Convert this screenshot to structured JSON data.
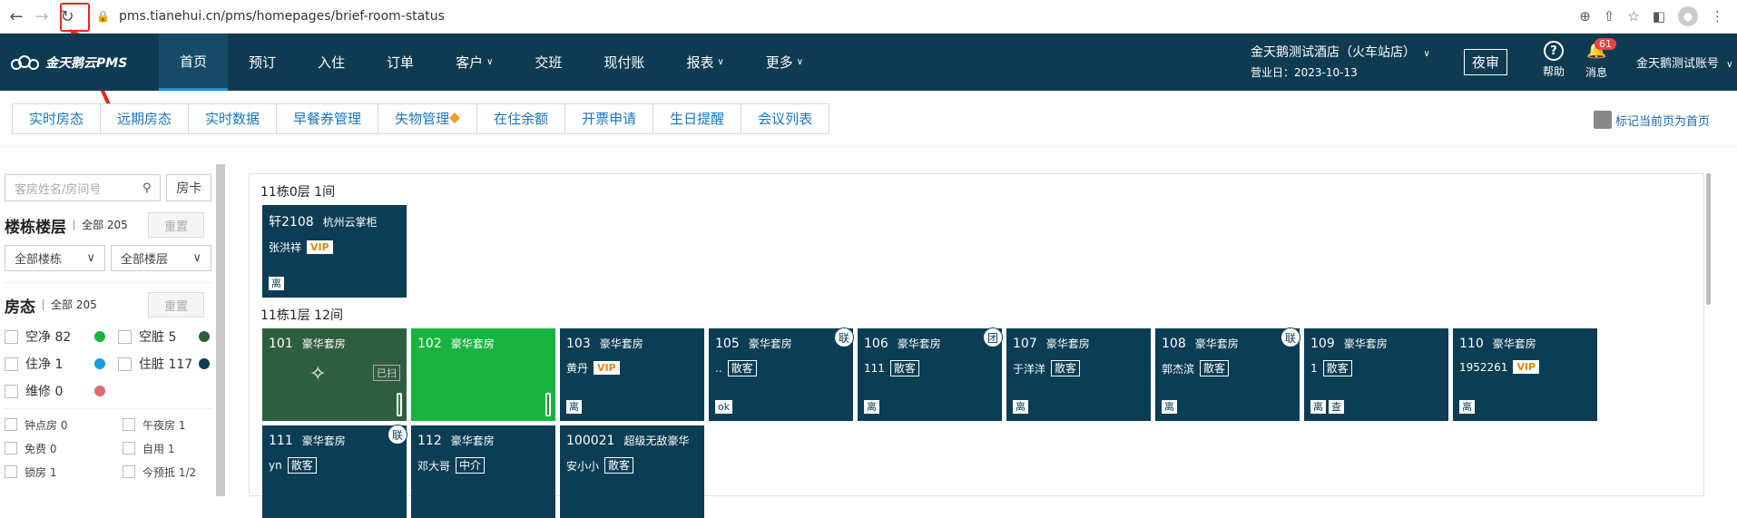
{
  "browser": {
    "url": "pms.tianehui.cn/pms/homepages/brief-room-status"
  },
  "nav": {
    "logo": "金天鹅云PMS",
    "items": [
      {
        "label": "首页",
        "active": true
      },
      {
        "label": "预订"
      },
      {
        "label": "入住"
      },
      {
        "label": "订单"
      },
      {
        "label": "客户",
        "dropdown": true
      },
      {
        "label": "交班"
      },
      {
        "label": "现付账"
      },
      {
        "label": "报表",
        "dropdown": true
      },
      {
        "label": "更多",
        "dropdown": true
      }
    ],
    "hotel_name": "金天鹅测试酒店（火车站店）",
    "business_day": "营业日：2023-10-13",
    "night_audit": "夜审",
    "help": "帮助",
    "messages": "消息",
    "message_count": "61",
    "account": "金天鹅测试账号"
  },
  "tabs": [
    "实时房态",
    "远期房态",
    "实时数据",
    "早餐券管理",
    "失物管理",
    "在住余额",
    "开票申请",
    "生日提醒",
    "会议列表"
  ],
  "mark_home": "标记当前页为首页",
  "sidebar": {
    "search_placeholder": "客房姓名/房间号",
    "card_button": "房卡",
    "building_title": "楼栋楼层",
    "building_all": "全部 205",
    "reset": "重置",
    "building_select": "全部楼栋",
    "floor_select": "全部楼层",
    "status_title": "房态",
    "status_all": "全部 205",
    "statuses": [
      {
        "label": "空净 82",
        "color": "#19b43f"
      },
      {
        "label": "空脏 5",
        "color": "#2f5e3f"
      },
      {
        "label": "住净 1",
        "color": "#1e9be0"
      },
      {
        "label": "住脏 117",
        "color": "#0b3d55"
      },
      {
        "label": "维修 0",
        "color": "#e06a6a"
      }
    ],
    "extras": [
      "钟点房 0",
      "午夜房 1",
      "免费 0",
      "自用 1",
      "锁房 1",
      "今预抵 1/2"
    ]
  },
  "floors": [
    {
      "title": "11栋0层 1间",
      "rooms": [
        {
          "num": "轩2108",
          "type": "杭州云掌柜",
          "guest": "张洪祥",
          "vip": "VIP",
          "tags": [
            "离"
          ]
        }
      ]
    },
    {
      "title": "11栋1层 12间",
      "rooms": [
        {
          "num": "101",
          "type": "豪华套房",
          "state": "dirty",
          "cleaned": "已扫"
        },
        {
          "num": "102",
          "type": "豪华套房",
          "state": "green"
        },
        {
          "num": "103",
          "type": "豪华套房",
          "guest": "黄丹",
          "vip": "VIP",
          "tags": [
            "离"
          ]
        },
        {
          "num": "105",
          "type": "豪华套房",
          "guest": "..",
          "label": "散客",
          "tags": [
            "ok"
          ],
          "link": "联"
        },
        {
          "num": "106",
          "type": "豪华套房",
          "guest": "111",
          "label": "散客",
          "tags": [
            "离"
          ],
          "link": "团"
        },
        {
          "num": "107",
          "type": "豪华套房",
          "guest": "于洋洋",
          "label": "散客",
          "tags": [
            "离"
          ]
        },
        {
          "num": "108",
          "type": "豪华套房",
          "guest": "郭杰滨",
          "label": "散客",
          "tags": [
            "离"
          ],
          "link": "联"
        },
        {
          "num": "109",
          "type": "豪华套房",
          "guest": "1",
          "label": "散客",
          "tags": [
            "离",
            "查"
          ]
        },
        {
          "num": "110",
          "type": "豪华套房",
          "guest": "1952261",
          "vip": "VIP",
          "tags": [
            "离"
          ]
        },
        {
          "num": "111",
          "type": "豪华套房",
          "guest": "yn",
          "label": "散客",
          "link": "联"
        },
        {
          "num": "112",
          "type": "豪华套房",
          "guest": "邓大哥",
          "label": "中介"
        },
        {
          "num": "100021",
          "type": "超级无敌豪华",
          "guest": "安小小",
          "label": "散客"
        }
      ]
    }
  ]
}
